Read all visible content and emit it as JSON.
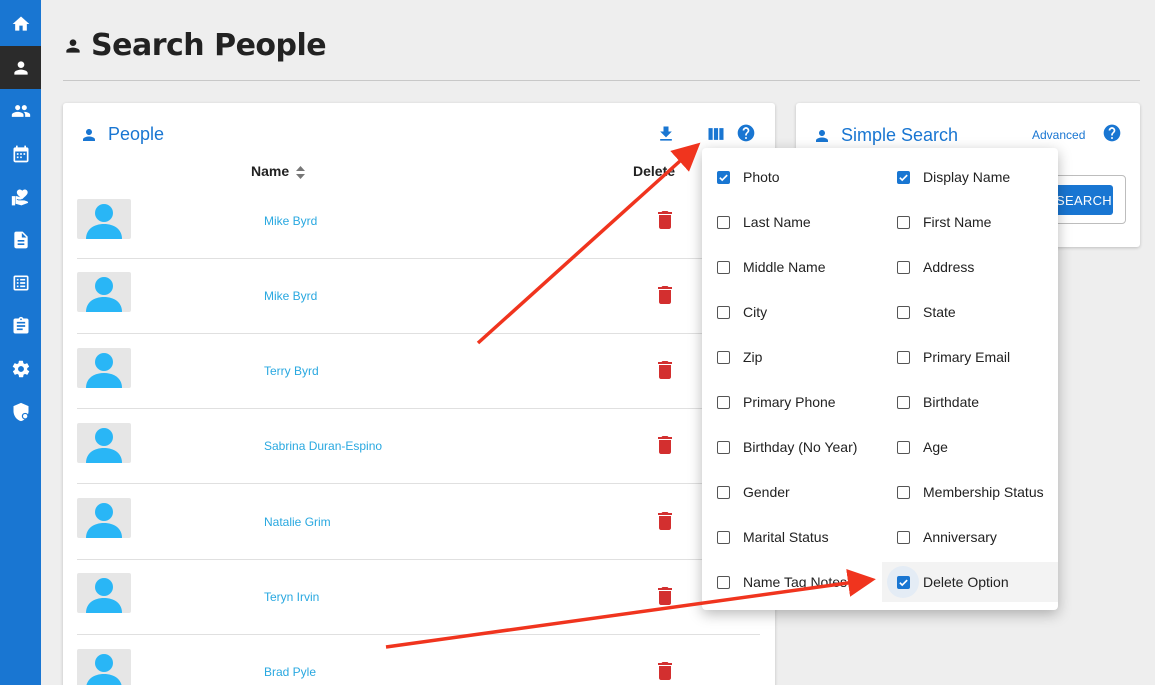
{
  "sidebar": {
    "items": [
      {
        "icon": "home-icon"
      },
      {
        "icon": "person-icon",
        "active": true
      },
      {
        "icon": "group-icon"
      },
      {
        "icon": "calendar-icon"
      },
      {
        "icon": "donation-icon"
      },
      {
        "icon": "document-icon"
      },
      {
        "icon": "list-icon"
      },
      {
        "icon": "clipboard-icon"
      },
      {
        "icon": "gear-icon"
      },
      {
        "icon": "shield-icon"
      }
    ]
  },
  "header": {
    "title": "Search People",
    "icon": "person-icon"
  },
  "people_card": {
    "title": "People",
    "icons": [
      "download-icon",
      "columns-icon",
      "help-icon"
    ],
    "columns": {
      "name": "Name",
      "delete": "Delete"
    },
    "rows": [
      {
        "name": "Mike Byrd"
      },
      {
        "name": "Mike Byrd"
      },
      {
        "name": "Terry Byrd"
      },
      {
        "name": "Sabrina Duran-Espino"
      },
      {
        "name": "Natalie Grim"
      },
      {
        "name": "Teryn Irvin"
      },
      {
        "name": "Brad Pyle"
      }
    ]
  },
  "search_card": {
    "title": "Simple Search",
    "advanced_label": "Advanced",
    "search_button": "SEARCH"
  },
  "column_chooser": {
    "options": [
      {
        "label": "Photo",
        "checked": true
      },
      {
        "label": "Display Name",
        "checked": true
      },
      {
        "label": "Last Name",
        "checked": false
      },
      {
        "label": "First Name",
        "checked": false
      },
      {
        "label": "Middle Name",
        "checked": false
      },
      {
        "label": "Address",
        "checked": false
      },
      {
        "label": "City",
        "checked": false
      },
      {
        "label": "State",
        "checked": false
      },
      {
        "label": "Zip",
        "checked": false
      },
      {
        "label": "Primary Email",
        "checked": false
      },
      {
        "label": "Primary Phone",
        "checked": false
      },
      {
        "label": "Birthdate",
        "checked": false
      },
      {
        "label": "Birthday (No Year)",
        "checked": false
      },
      {
        "label": "Age",
        "checked": false
      },
      {
        "label": "Gender",
        "checked": false
      },
      {
        "label": "Membership Status",
        "checked": false
      },
      {
        "label": "Marital Status",
        "checked": false
      },
      {
        "label": "Anniversary",
        "checked": false
      },
      {
        "label": "Name Tag Notes",
        "checked": false
      },
      {
        "label": "Delete Option",
        "checked": true
      }
    ]
  },
  "colors": {
    "primary": "#1976d2",
    "link": "#29a8e0",
    "danger": "#d32f2f",
    "annotation": "#f0341e"
  }
}
